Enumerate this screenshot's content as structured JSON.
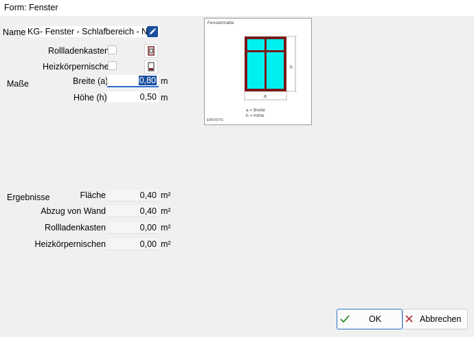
{
  "window": {
    "title": "Form: Fenster"
  },
  "name_field": {
    "label": "Name",
    "value": "KG- Fenster - Schlafbereich - NW"
  },
  "options": {
    "rollladenkasten": {
      "label": "Rollladenkasten",
      "checked": false
    },
    "heizkoerpernische": {
      "label": "Heizkörpernische",
      "checked": false
    }
  },
  "masse": {
    "section_label": "Maße",
    "breite": {
      "label": "Breite (a)",
      "value": "0,80",
      "unit": "m"
    },
    "hoehe": {
      "label": "Höhe (h)",
      "value": "0,50",
      "unit": "m"
    }
  },
  "diagram": {
    "title": "Fenstermaße",
    "dim_h": "h",
    "dim_a": "a",
    "legend_a": "a = Breite",
    "legend_h": "h = Höhe",
    "footer": "ENVISYS"
  },
  "ergebnisse": {
    "section_label": "Ergebnisse",
    "rows": [
      {
        "label": "Fläche",
        "value": "0,40",
        "unit": "m²"
      },
      {
        "label": "Abzug von Wand",
        "value": "0,40",
        "unit": "m²"
      },
      {
        "label": "Rollladenkasten",
        "value": "0,00",
        "unit": "m²"
      },
      {
        "label": "Heizkörpernischen",
        "value": "0,00",
        "unit": "m²"
      }
    ]
  },
  "buttons": {
    "ok": "OK",
    "cancel": "Abbrechen"
  },
  "colors": {
    "accent": "#1a4fa0",
    "glass": "#00f0f0",
    "frame": "#7a1a1a"
  }
}
